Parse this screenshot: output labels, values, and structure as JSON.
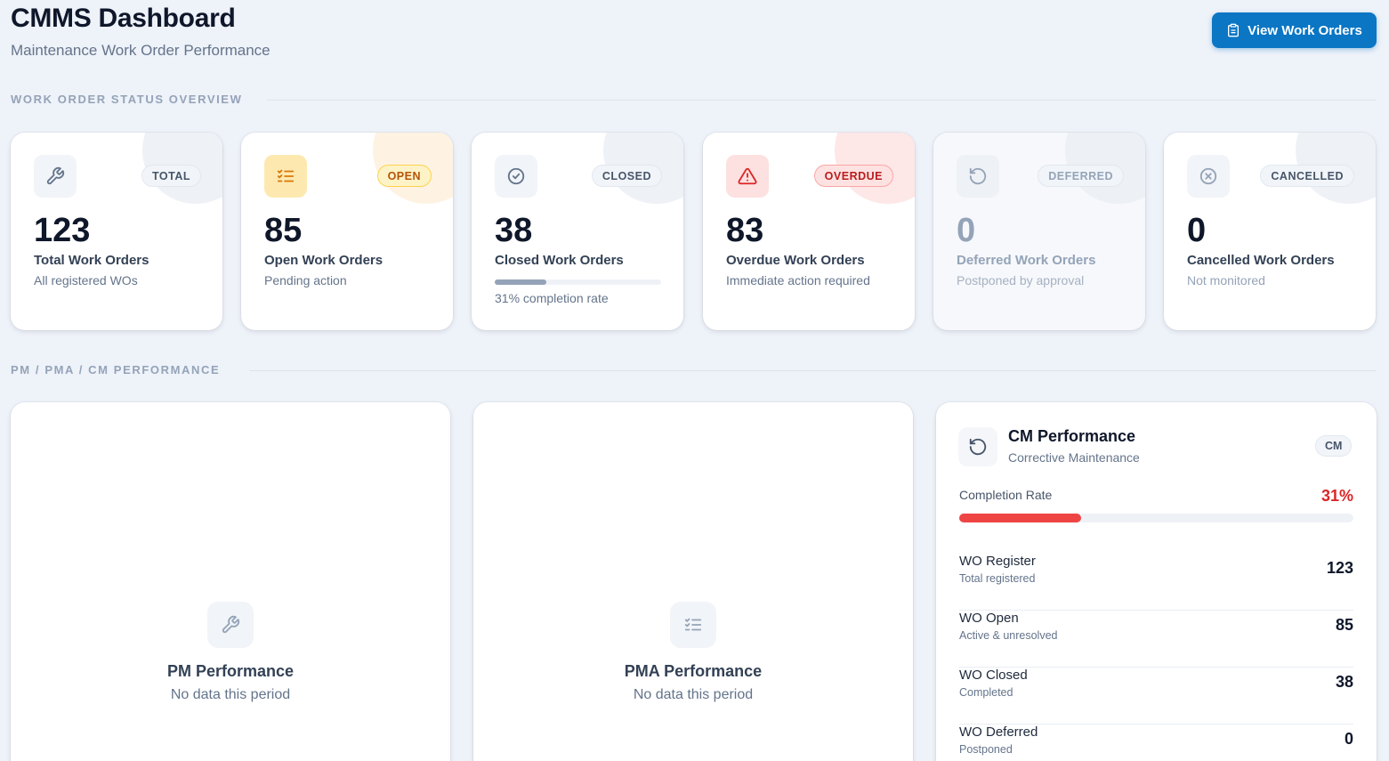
{
  "header": {
    "title": "CMMS Dashboard",
    "subtitle": "Maintenance Work Order Performance",
    "view_button_label": "View Work Orders"
  },
  "sections": {
    "status_overview": "WORK ORDER STATUS OVERVIEW",
    "performance": "PM / PMA / CM PERFORMANCE"
  },
  "stats": {
    "total": {
      "badge": "TOTAL",
      "value": "123",
      "label": "Total Work Orders",
      "sub": "All registered WOs",
      "icon": "wrench-icon"
    },
    "open": {
      "badge": "OPEN",
      "value": "85",
      "label": "Open Work Orders",
      "sub": "Pending action",
      "icon": "list-check-icon"
    },
    "closed": {
      "badge": "CLOSED",
      "value": "38",
      "label": "Closed Work Orders",
      "progress": 0.31,
      "progress_text": "31% completion rate",
      "icon": "check-circle-icon"
    },
    "overdue": {
      "badge": "OVERDUE",
      "value": "83",
      "label": "Overdue Work Orders",
      "sub": "Immediate action required",
      "icon": "alert-triangle-icon"
    },
    "deferred": {
      "badge": "DEFERRED",
      "value": "0",
      "label": "Deferred Work Orders",
      "sub": "Postponed by approval",
      "icon": "rotate-ccw-icon"
    },
    "cancelled": {
      "badge": "CANCELLED",
      "value": "0",
      "label": "Cancelled Work Orders",
      "sub": "Not monitored",
      "icon": "x-circle-icon"
    }
  },
  "pm": {
    "title": "PM Performance",
    "sub": "No data this period",
    "icon": "wrench-icon"
  },
  "pma": {
    "title": "PMA Performance",
    "sub": "No data this period",
    "icon": "list-check-icon"
  },
  "cm": {
    "title": "CM Performance",
    "sub": "Corrective Maintenance",
    "badge": "CM",
    "icon": "rotate-ccw-icon",
    "rate_label": "Completion Rate",
    "rate_value": "31%",
    "rate": 0.31,
    "rows": [
      {
        "label": "WO Register",
        "sub": "Total registered",
        "value": "123"
      },
      {
        "label": "WO Open",
        "sub": "Active & unresolved",
        "value": "85"
      },
      {
        "label": "WO Closed",
        "sub": "Completed",
        "value": "38"
      },
      {
        "label": "WO Deferred",
        "sub": "Postponed",
        "value": "0"
      }
    ]
  },
  "colors": {
    "primary": "#0a76c4",
    "open": "#d97706",
    "overdue": "#dc2626",
    "muted": "#94a3b8",
    "page_bg": "#eef2f9"
  }
}
